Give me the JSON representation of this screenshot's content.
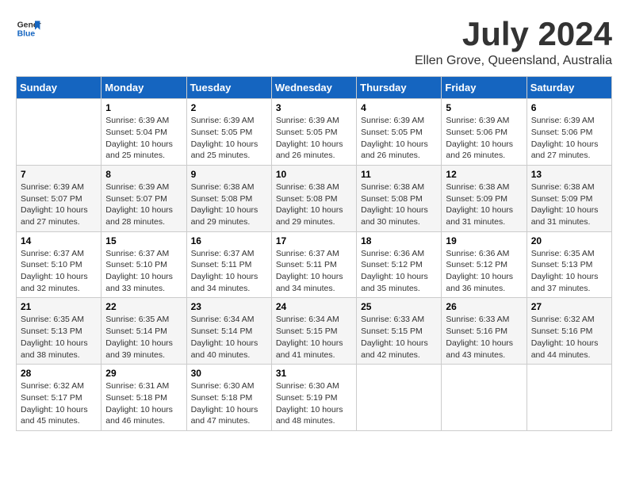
{
  "header": {
    "logo_line1": "General",
    "logo_line2": "Blue",
    "month_title": "July 2024",
    "location": "Ellen Grove, Queensland, Australia"
  },
  "calendar": {
    "days_of_week": [
      "Sunday",
      "Monday",
      "Tuesday",
      "Wednesday",
      "Thursday",
      "Friday",
      "Saturday"
    ],
    "weeks": [
      [
        {
          "day": "",
          "info": ""
        },
        {
          "day": "1",
          "info": "Sunrise: 6:39 AM\nSunset: 5:04 PM\nDaylight: 10 hours\nand 25 minutes."
        },
        {
          "day": "2",
          "info": "Sunrise: 6:39 AM\nSunset: 5:05 PM\nDaylight: 10 hours\nand 25 minutes."
        },
        {
          "day": "3",
          "info": "Sunrise: 6:39 AM\nSunset: 5:05 PM\nDaylight: 10 hours\nand 26 minutes."
        },
        {
          "day": "4",
          "info": "Sunrise: 6:39 AM\nSunset: 5:05 PM\nDaylight: 10 hours\nand 26 minutes."
        },
        {
          "day": "5",
          "info": "Sunrise: 6:39 AM\nSunset: 5:06 PM\nDaylight: 10 hours\nand 26 minutes."
        },
        {
          "day": "6",
          "info": "Sunrise: 6:39 AM\nSunset: 5:06 PM\nDaylight: 10 hours\nand 27 minutes."
        }
      ],
      [
        {
          "day": "7",
          "info": ""
        },
        {
          "day": "8",
          "info": "Sunrise: 6:39 AM\nSunset: 5:07 PM\nDaylight: 10 hours\nand 28 minutes."
        },
        {
          "day": "9",
          "info": "Sunrise: 6:38 AM\nSunset: 5:08 PM\nDaylight: 10 hours\nand 29 minutes."
        },
        {
          "day": "10",
          "info": "Sunrise: 6:38 AM\nSunset: 5:08 PM\nDaylight: 10 hours\nand 29 minutes."
        },
        {
          "day": "11",
          "info": "Sunrise: 6:38 AM\nSunset: 5:08 PM\nDaylight: 10 hours\nand 30 minutes."
        },
        {
          "day": "12",
          "info": "Sunrise: 6:38 AM\nSunset: 5:09 PM\nDaylight: 10 hours\nand 31 minutes."
        },
        {
          "day": "13",
          "info": "Sunrise: 6:38 AM\nSunset: 5:09 PM\nDaylight: 10 hours\nand 31 minutes."
        }
      ],
      [
        {
          "day": "14",
          "info": ""
        },
        {
          "day": "15",
          "info": "Sunrise: 6:37 AM\nSunset: 5:10 PM\nDaylight: 10 hours\nand 33 minutes."
        },
        {
          "day": "16",
          "info": "Sunrise: 6:37 AM\nSunset: 5:11 PM\nDaylight: 10 hours\nand 34 minutes."
        },
        {
          "day": "17",
          "info": "Sunrise: 6:37 AM\nSunset: 5:11 PM\nDaylight: 10 hours\nand 34 minutes."
        },
        {
          "day": "18",
          "info": "Sunrise: 6:36 AM\nSunset: 5:12 PM\nDaylight: 10 hours\nand 35 minutes."
        },
        {
          "day": "19",
          "info": "Sunrise: 6:36 AM\nSunset: 5:12 PM\nDaylight: 10 hours\nand 36 minutes."
        },
        {
          "day": "20",
          "info": "Sunrise: 6:35 AM\nSunset: 5:13 PM\nDaylight: 10 hours\nand 37 minutes."
        }
      ],
      [
        {
          "day": "21",
          "info": ""
        },
        {
          "day": "22",
          "info": "Sunrise: 6:35 AM\nSunset: 5:14 PM\nDaylight: 10 hours\nand 39 minutes."
        },
        {
          "day": "23",
          "info": "Sunrise: 6:34 AM\nSunset: 5:14 PM\nDaylight: 10 hours\nand 40 minutes."
        },
        {
          "day": "24",
          "info": "Sunrise: 6:34 AM\nSunset: 5:15 PM\nDaylight: 10 hours\nand 41 minutes."
        },
        {
          "day": "25",
          "info": "Sunrise: 6:33 AM\nSunset: 5:15 PM\nDaylight: 10 hours\nand 42 minutes."
        },
        {
          "day": "26",
          "info": "Sunrise: 6:33 AM\nSunset: 5:16 PM\nDaylight: 10 hours\nand 43 minutes."
        },
        {
          "day": "27",
          "info": "Sunrise: 6:32 AM\nSunset: 5:16 PM\nDaylight: 10 hours\nand 44 minutes."
        }
      ],
      [
        {
          "day": "28",
          "info": "Sunrise: 6:32 AM\nSunset: 5:17 PM\nDaylight: 10 hours\nand 45 minutes."
        },
        {
          "day": "29",
          "info": "Sunrise: 6:31 AM\nSunset: 5:18 PM\nDaylight: 10 hours\nand 46 minutes."
        },
        {
          "day": "30",
          "info": "Sunrise: 6:30 AM\nSunset: 5:18 PM\nDaylight: 10 hours\nand 47 minutes."
        },
        {
          "day": "31",
          "info": "Sunrise: 6:30 AM\nSunset: 5:19 PM\nDaylight: 10 hours\nand 48 minutes."
        },
        {
          "day": "",
          "info": ""
        },
        {
          "day": "",
          "info": ""
        },
        {
          "day": "",
          "info": ""
        }
      ]
    ],
    "week1_sunday_info": "Sunrise: 6:39 AM\nSunset: 5:07 PM\nDaylight: 10 hours\nand 27 minutes.",
    "week2_sunday_info": "Sunrise: 6:37 AM\nSunset: 5:10 PM\nDaylight: 10 hours\nand 32 minutes.",
    "week3_sunday_info": "Sunrise: 6:35 AM\nSunset: 5:13 PM\nDaylight: 10 hours\nand 38 minutes."
  }
}
